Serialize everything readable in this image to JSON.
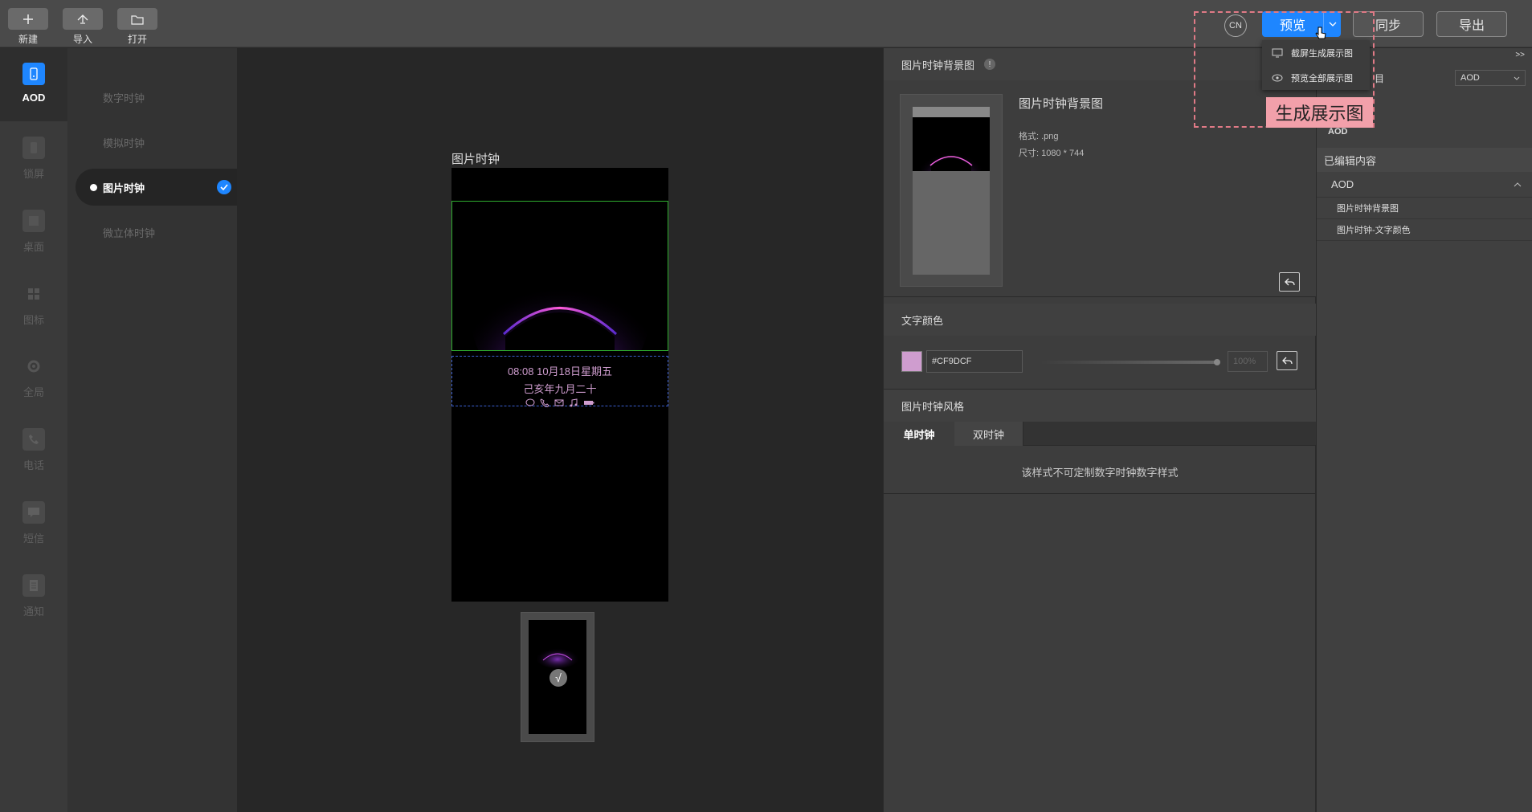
{
  "toolbar": {
    "new_label": "新建",
    "import_label": "导入",
    "open_label": "打开",
    "lang_label": "CN",
    "preview_label": "预览",
    "sync_label": "同步",
    "export_label": "导出",
    "accent_color": "#1E86FF"
  },
  "preview_menu": {
    "items": [
      {
        "label": "截屏生成展示图",
        "icon": "screenshot-icon"
      },
      {
        "label": "预览全部展示图",
        "icon": "eye-icon"
      }
    ]
  },
  "callout": {
    "text": "生成展示图"
  },
  "rail": {
    "items": [
      {
        "label": "AOD",
        "icon": "phone-icon",
        "active": true
      },
      {
        "label": "锁屏",
        "icon": "lock-screen-icon"
      },
      {
        "label": "桌面",
        "icon": "desktop-icon"
      },
      {
        "label": "图标",
        "icon": "grid-icon"
      },
      {
        "label": "全局",
        "icon": "gear-icon"
      },
      {
        "label": "电话",
        "icon": "phone-call-icon"
      },
      {
        "label": "短信",
        "icon": "message-icon"
      },
      {
        "label": "通知",
        "icon": "notification-icon"
      }
    ]
  },
  "subnav": {
    "items": [
      {
        "label": "数字时钟"
      },
      {
        "label": "模拟时钟"
      },
      {
        "label": "图片时钟",
        "active": true
      },
      {
        "label": "微立体时钟"
      }
    ]
  },
  "canvas": {
    "title": "图片时钟",
    "time_line": "08:08  10月18日星期五",
    "lunar_line": "己亥年九月二十",
    "status_icons": [
      "chat-icon",
      "phone-icon",
      "mail-icon",
      "music-icon",
      "battery-icon"
    ],
    "text_color": "#CF9DCF"
  },
  "props": {
    "bg_section_title": "图片时钟背景图",
    "bg_name": "图片时钟背景图",
    "bg_format": "格式: .png",
    "bg_size": "尺寸: 1080 * 744",
    "color_section_title": "文字颜色",
    "color_hex": "#CF9DCF",
    "opacity": "100%",
    "style_section_title": "图片时钟风格",
    "tabs": [
      "单时钟",
      "双时钟"
    ],
    "note": "该样式不可定制数字时钟数字样式"
  },
  "edited": {
    "collapse_label": ">>",
    "row_label_partial": "目",
    "select_value": "AOD",
    "aod_label": "AOD",
    "edited_title": "已编辑内容",
    "group_label": "AOD",
    "items": [
      "图片时钟背景图",
      "图片时钟-文字颜色"
    ]
  }
}
